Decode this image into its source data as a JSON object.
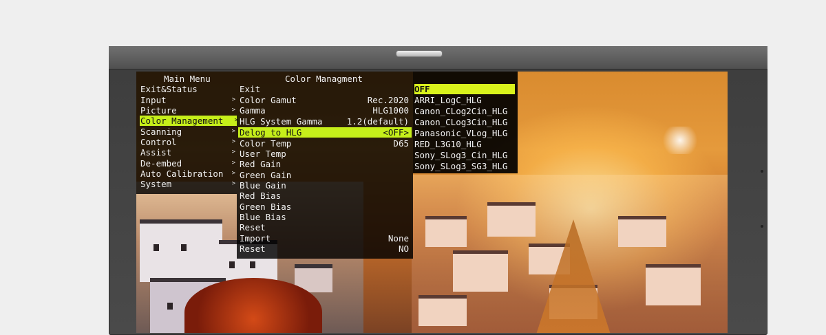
{
  "main_menu": {
    "title": "Main Menu",
    "items": [
      {
        "label": "Exit&Status",
        "arrow": false,
        "selected": false
      },
      {
        "label": "Input",
        "arrow": true,
        "selected": false
      },
      {
        "label": "Picture",
        "arrow": true,
        "selected": false
      },
      {
        "label": "Color Management",
        "arrow": true,
        "selected": true
      },
      {
        "label": "Scanning",
        "arrow": true,
        "selected": false
      },
      {
        "label": "Control",
        "arrow": true,
        "selected": false
      },
      {
        "label": "Assist",
        "arrow": true,
        "selected": false
      },
      {
        "label": "De-embed",
        "arrow": true,
        "selected": false
      },
      {
        "label": "Auto Calibration",
        "arrow": true,
        "selected": false
      },
      {
        "label": "System",
        "arrow": true,
        "selected": false
      }
    ]
  },
  "color_menu": {
    "title": "Color Managment",
    "items": [
      {
        "label": "Exit",
        "value": "",
        "selected": false
      },
      {
        "label": "Color Gamut",
        "value": "Rec.2020",
        "selected": false
      },
      {
        "label": "Gamma",
        "value": "HLG1000",
        "selected": false
      },
      {
        "label": "HLG System Gamma",
        "value": "1.2(default)",
        "selected": false
      },
      {
        "label": "Delog to HLG",
        "value": "<OFF>",
        "selected": true
      },
      {
        "label": "Color Temp",
        "value": "D65",
        "selected": false
      },
      {
        "label": "User Temp",
        "value": "",
        "selected": false
      },
      {
        "label": "Red Gain",
        "value": "",
        "selected": false
      },
      {
        "label": "Green Gain",
        "value": "",
        "selected": false
      },
      {
        "label": "Blue Gain",
        "value": "",
        "selected": false
      },
      {
        "label": "Red Bias",
        "value": "",
        "selected": false
      },
      {
        "label": "Green Bias",
        "value": "",
        "selected": false
      },
      {
        "label": "Blue Bias",
        "value": "",
        "selected": false
      },
      {
        "label": "Reset",
        "value": "",
        "selected": false
      },
      {
        "label": "Import",
        "value": "None",
        "selected": false
      },
      {
        "label": "Reset",
        "value": "NO",
        "selected": false
      }
    ]
  },
  "delog_options": [
    {
      "label": "OFF",
      "selected": true
    },
    {
      "label": "ARRI_LogC_HLG",
      "selected": false
    },
    {
      "label": "Canon_CLog2Cin_HLG",
      "selected": false
    },
    {
      "label": "Canon_CLog3Cin_HLG",
      "selected": false
    },
    {
      "label": "Panasonic_VLog_HLG",
      "selected": false
    },
    {
      "label": "RED_L3G10_HLG",
      "selected": false
    },
    {
      "label": "Sony_SLog3_Cin_HLG",
      "selected": false
    },
    {
      "label": "Sony_SLog3_SG3_HLG",
      "selected": false
    }
  ],
  "colors": {
    "highlight": "#c6ef1a",
    "osd_background": "#000000"
  }
}
